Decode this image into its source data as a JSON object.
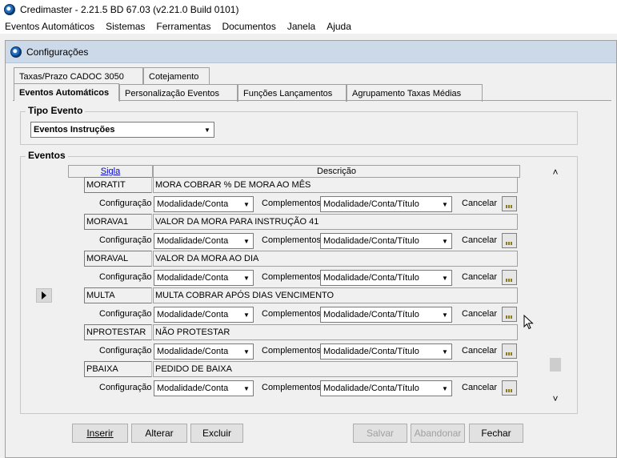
{
  "window": {
    "title": "Credimaster - 2.21.5 BD 67.03 (v2.21.0 Build 0101)"
  },
  "menu": [
    "Eventos Automáticos",
    "Sistemas",
    "Ferramentas",
    "Documentos",
    "Janela",
    "Ajuda"
  ],
  "dialog": {
    "title": "Configurações"
  },
  "tabs_row1": [
    "Taxas/Prazo CADOC 3050",
    "Cotejamento"
  ],
  "tabs_row2": [
    "Eventos Automáticos",
    "Personalização Eventos",
    "Funções Lançamentos",
    "Agrupamento Taxas Médias"
  ],
  "tipo_evento": {
    "label": "Tipo Evento",
    "value": "Eventos Instruções"
  },
  "eventos": {
    "label": "Eventos",
    "headers": {
      "sigla": "Sigla",
      "descricao": "Descrição"
    },
    "row_labels": {
      "configuracao": "Configuração",
      "complementos": "Complementos",
      "cancelar": "Cancelar"
    },
    "rows": [
      {
        "sigla": "MORATIT",
        "descricao": "MORA COBRAR % DE MORA AO MÊS",
        "configuracao": "Modalidade/Conta",
        "complementos": "Modalidade/Conta/Título"
      },
      {
        "sigla": "MORAVA1",
        "descricao": "VALOR DA MORA PARA INSTRUÇÃO 41",
        "configuracao": "Modalidade/Conta",
        "complementos": "Modalidade/Conta/Título"
      },
      {
        "sigla": "MORAVAL",
        "descricao": "VALOR DA MORA AO DIA",
        "configuracao": "Modalidade/Conta",
        "complementos": "Modalidade/Conta/Título"
      },
      {
        "sigla": "MULTA",
        "descricao": "MULTA COBRAR APÓS DIAS VENCIMENTO",
        "configuracao": "Modalidade/Conta",
        "complementos": "Modalidade/Conta/Título"
      },
      {
        "sigla": "NPROTESTAR",
        "descricao": "NÃO PROTESTAR",
        "configuracao": "Modalidade/Conta",
        "complementos": "Modalidade/Conta/Título"
      },
      {
        "sigla": "PBAIXA",
        "descricao": "PEDIDO DE BAIXA",
        "configuracao": "Modalidade/Conta",
        "complementos": "Modalidade/Conta/Título"
      }
    ]
  },
  "buttons": {
    "inserir": "Inserir",
    "alterar": "Alterar",
    "excluir": "Excluir",
    "salvar": "Salvar",
    "abandonar": "Abandonar",
    "fechar": "Fechar"
  },
  "colors": {
    "sigla_header": "#0000c8",
    "dialog_title_bg": "#cbd9e9"
  }
}
